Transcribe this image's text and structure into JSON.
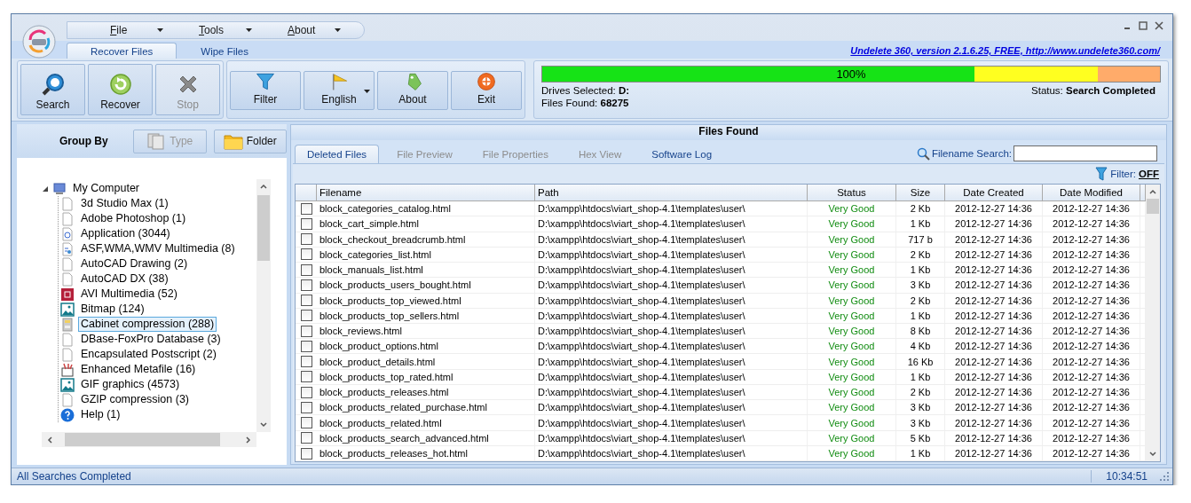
{
  "window": {
    "title_menu": [
      {
        "label": "File"
      },
      {
        "label": "Tools"
      },
      {
        "label": "About"
      }
    ],
    "link": "Undelete 360, version 2.1.6.25, FREE, http://www.undelete360.com/"
  },
  "ribbon_tabs": [
    {
      "label": "Recover Files",
      "selected": true
    },
    {
      "label": "Wipe Files",
      "selected": false
    }
  ],
  "toolbar": [
    {
      "group": [
        {
          "label": "Search",
          "kind": "search",
          "disabled": false
        },
        {
          "label": "Recover",
          "kind": "recover",
          "disabled": false
        },
        {
          "label": "Stop",
          "kind": "stop",
          "disabled": true
        }
      ]
    },
    {
      "group": [
        {
          "label": "Filter",
          "kind": "filter",
          "disabled": false
        },
        {
          "label": "English",
          "kind": "language",
          "disabled": false,
          "dropdown": true
        },
        {
          "label": "About",
          "kind": "about",
          "disabled": false
        },
        {
          "label": "Exit",
          "kind": "exit",
          "disabled": false
        }
      ]
    }
  ],
  "progress": {
    "level": 1,
    "reading": "100%",
    "drives_label": "Drives Selected:",
    "drives": "D:",
    "found_label": "Files Found:",
    "found": "68275",
    "status_label": "Status:",
    "status": "Search Completed"
  },
  "group_by": {
    "label": "Group By",
    "buttons": [
      {
        "label": "Type",
        "kind": "type",
        "disabled": true
      },
      {
        "label": "Folder",
        "kind": "folder",
        "disabled": false
      }
    ]
  },
  "tree": [
    {
      "label": "My Computer",
      "kind": "computer",
      "expanded": true,
      "selected": false,
      "children": [
        {
          "label": "3d Studio Max (1)",
          "kind": "document",
          "selected": false
        },
        {
          "label": "Adobe Photoshop (1)",
          "kind": "document",
          "selected": false
        },
        {
          "label": "Application (3044)",
          "kind": "application",
          "selected": false
        },
        {
          "label": "ASF,WMA,WMV Multimedia (8)",
          "kind": "media",
          "selected": false
        },
        {
          "label": "AutoCAD Drawing (2)",
          "kind": "document",
          "selected": false
        },
        {
          "label": "AutoCAD DX (38)",
          "kind": "document",
          "selected": false
        },
        {
          "label": "AVI Multimedia (52)",
          "kind": "video",
          "selected": false
        },
        {
          "label": "Bitmap (124)",
          "kind": "image",
          "selected": false
        },
        {
          "label": "Cabinet compression (288)",
          "kind": "cabinet",
          "selected": true
        },
        {
          "label": "DBase-FoxPro Database (3)",
          "kind": "document",
          "selected": false
        },
        {
          "label": "Encapsulated Postscript (2)",
          "kind": "document",
          "selected": false
        },
        {
          "label": "Enhanced Metafile (16)",
          "kind": "metafile",
          "selected": false
        },
        {
          "label": "GIF graphics (4573)",
          "kind": "image",
          "selected": false
        },
        {
          "label": "GZIP compression (3)",
          "kind": "document",
          "selected": false
        },
        {
          "label": "Help (1)",
          "kind": "help",
          "selected": false
        }
      ]
    }
  ],
  "files_panel": {
    "title": "Files Found",
    "tabs": [
      {
        "label": "Deleted Files",
        "selected": true,
        "disabled": false
      },
      {
        "label": "File Preview",
        "selected": false,
        "disabled": true
      },
      {
        "label": "File Properties",
        "selected": false,
        "disabled": true
      },
      {
        "label": "Hex View",
        "selected": false,
        "disabled": true
      },
      {
        "label": "Software Log",
        "selected": false,
        "disabled": false
      }
    ],
    "search_label": "Filename Search:",
    "filter_label": "Filter:",
    "filter_value": "OFF",
    "table": {
      "columns": [
        "Filename",
        "Path",
        "Status",
        "Size",
        "Date Created",
        "Date Modified"
      ],
      "rows": [
        {
          "checked": false,
          "cells": [
            "block_categories_catalog.html",
            "D:\\xampp\\htdocs\\viart_shop-4.1\\templates\\user\\",
            "Very Good",
            "2 Kb",
            "2012-12-27 14:36",
            "2012-12-27 14:36"
          ]
        },
        {
          "checked": false,
          "cells": [
            "block_cart_simple.html",
            "D:\\xampp\\htdocs\\viart_shop-4.1\\templates\\user\\",
            "Very Good",
            "1 Kb",
            "2012-12-27 14:36",
            "2012-12-27 14:36"
          ]
        },
        {
          "checked": false,
          "cells": [
            "block_checkout_breadcrumb.html",
            "D:\\xampp\\htdocs\\viart_shop-4.1\\templates\\user\\",
            "Very Good",
            "717 b",
            "2012-12-27 14:36",
            "2012-12-27 14:36"
          ]
        },
        {
          "checked": false,
          "cells": [
            "block_categories_list.html",
            "D:\\xampp\\htdocs\\viart_shop-4.1\\templates\\user\\",
            "Very Good",
            "2 Kb",
            "2012-12-27 14:36",
            "2012-12-27 14:36"
          ]
        },
        {
          "checked": false,
          "cells": [
            "block_manuals_list.html",
            "D:\\xampp\\htdocs\\viart_shop-4.1\\templates\\user\\",
            "Very Good",
            "1 Kb",
            "2012-12-27 14:36",
            "2012-12-27 14:36"
          ]
        },
        {
          "checked": false,
          "cells": [
            "block_products_users_bought.html",
            "D:\\xampp\\htdocs\\viart_shop-4.1\\templates\\user\\",
            "Very Good",
            "3 Kb",
            "2012-12-27 14:36",
            "2012-12-27 14:36"
          ]
        },
        {
          "checked": false,
          "cells": [
            "block_products_top_viewed.html",
            "D:\\xampp\\htdocs\\viart_shop-4.1\\templates\\user\\",
            "Very Good",
            "2 Kb",
            "2012-12-27 14:36",
            "2012-12-27 14:36"
          ]
        },
        {
          "checked": false,
          "cells": [
            "block_products_top_sellers.html",
            "D:\\xampp\\htdocs\\viart_shop-4.1\\templates\\user\\",
            "Very Good",
            "1 Kb",
            "2012-12-27 14:36",
            "2012-12-27 14:36"
          ]
        },
        {
          "checked": false,
          "cells": [
            "block_reviews.html",
            "D:\\xampp\\htdocs\\viart_shop-4.1\\templates\\user\\",
            "Very Good",
            "8 Kb",
            "2012-12-27 14:36",
            "2012-12-27 14:36"
          ]
        },
        {
          "checked": false,
          "cells": [
            "block_product_options.html",
            "D:\\xampp\\htdocs\\viart_shop-4.1\\templates\\user\\",
            "Very Good",
            "4 Kb",
            "2012-12-27 14:36",
            "2012-12-27 14:36"
          ]
        },
        {
          "checked": false,
          "cells": [
            "block_product_details.html",
            "D:\\xampp\\htdocs\\viart_shop-4.1\\templates\\user\\",
            "Very Good",
            "16 Kb",
            "2012-12-27 14:36",
            "2012-12-27 14:36"
          ]
        },
        {
          "checked": false,
          "cells": [
            "block_products_top_rated.html",
            "D:\\xampp\\htdocs\\viart_shop-4.1\\templates\\user\\",
            "Very Good",
            "1 Kb",
            "2012-12-27 14:36",
            "2012-12-27 14:36"
          ]
        },
        {
          "checked": false,
          "cells": [
            "block_products_releases.html",
            "D:\\xampp\\htdocs\\viart_shop-4.1\\templates\\user\\",
            "Very Good",
            "2 Kb",
            "2012-12-27 14:36",
            "2012-12-27 14:36"
          ]
        },
        {
          "checked": false,
          "cells": [
            "block_products_related_purchase.html",
            "D:\\xampp\\htdocs\\viart_shop-4.1\\templates\\user\\",
            "Very Good",
            "3 Kb",
            "2012-12-27 14:36",
            "2012-12-27 14:36"
          ]
        },
        {
          "checked": false,
          "cells": [
            "block_products_related.html",
            "D:\\xampp\\htdocs\\viart_shop-4.1\\templates\\user\\",
            "Very Good",
            "3 Kb",
            "2012-12-27 14:36",
            "2012-12-27 14:36"
          ]
        },
        {
          "checked": false,
          "cells": [
            "block_products_search_advanced.html",
            "D:\\xampp\\htdocs\\viart_shop-4.1\\templates\\user\\",
            "Very Good",
            "5 Kb",
            "2012-12-27 14:36",
            "2012-12-27 14:36"
          ]
        },
        {
          "checked": false,
          "cells": [
            "block_products_releases_hot.html",
            "D:\\xampp\\htdocs\\viart_shop-4.1\\templates\\user\\",
            "Very Good",
            "1 Kb",
            "2012-12-27 14:36",
            "2012-12-27 14:36"
          ]
        }
      ]
    }
  },
  "status_bar": {
    "message": "All Searches Completed",
    "time": "10:34:51"
  }
}
